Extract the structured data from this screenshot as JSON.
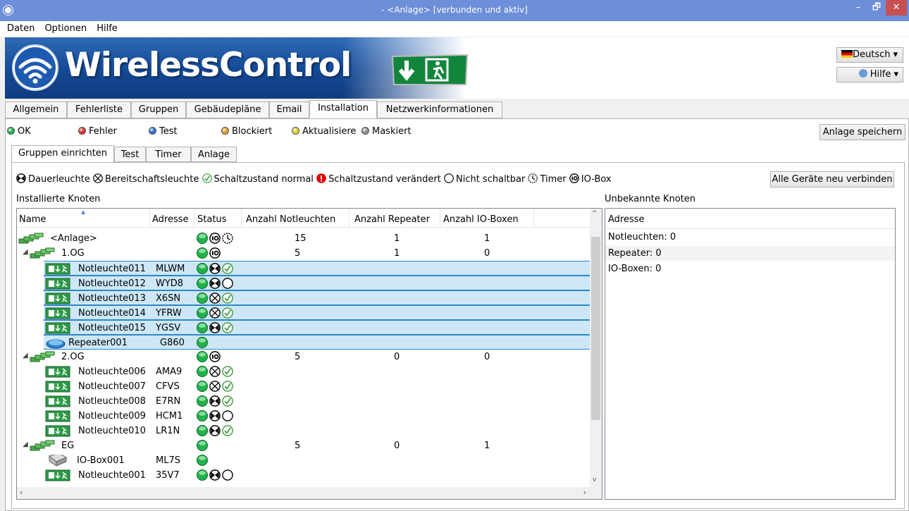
{
  "window": {
    "title": "- <Anlage> [verbunden und aktiv]",
    "minimize": "–",
    "maximize": "🗗",
    "close": "✕"
  },
  "menu": [
    "Daten",
    "Optionen",
    "Hilfe"
  ],
  "banner": {
    "brand": "WirelessControl"
  },
  "lang_button": "Deutsch",
  "help_button": "Hilfe",
  "main_tabs": [
    "Allgemein",
    "Fehlerliste",
    "Gruppen",
    "Gebäudepläne",
    "Email",
    "Installation",
    "Netzwerkinformationen"
  ],
  "active_main_tab": "Installation",
  "status_legend": [
    {
      "label": "OK",
      "color": "#22b14c"
    },
    {
      "label": "Fehler",
      "color": "#e03030"
    },
    {
      "label": "Test",
      "color": "#2f6fd0"
    },
    {
      "label": "Blockiert",
      "color": "#e69a28"
    },
    {
      "label": "Aktualisiere",
      "color": "#e6d028"
    },
    {
      "label": "Maskiert",
      "color": "#909090"
    }
  ],
  "save_button": "Anlage speichern",
  "sub_tabs": [
    "Gruppen einrichten",
    "Test",
    "Timer",
    "Anlage"
  ],
  "active_sub_tab": "Gruppen einrichten",
  "icon_legend": [
    {
      "icon": "maintained-light-icon",
      "label": "Dauerleuchte"
    },
    {
      "icon": "standby-light-icon",
      "label": "Bereitschaftsleuchte"
    },
    {
      "icon": "switch-normal-icon",
      "label": "Schaltzustand normal"
    },
    {
      "icon": "switch-changed-icon",
      "label": "Schaltzustand verändert"
    },
    {
      "icon": "not-switchable-icon",
      "label": "Nicht schaltbar"
    },
    {
      "icon": "timer-icon",
      "label": "Timer"
    },
    {
      "icon": "io-box-icon",
      "label": "IO-Box"
    }
  ],
  "reconnect_button": "Alle Geräte neu verbinden",
  "installed_label": "Installierte Knoten",
  "unknown_label": "Unbekannte Knoten",
  "columns": [
    "Name",
    "Adresse",
    "Status",
    "Anzahl Notleuchten",
    "Anzahl Repeater",
    "Anzahl IO-Boxen"
  ],
  "rows": [
    {
      "name": "<Anlage>",
      "addr": "",
      "level": 0,
      "type": "group",
      "expander": "",
      "status": [
        "ok",
        "io",
        "timer"
      ],
      "n": "15",
      "r": "1",
      "io": "1",
      "sel": false
    },
    {
      "name": "1.OG",
      "addr": "",
      "level": 1,
      "type": "group",
      "expander": "◢",
      "status": [
        "ok",
        "io"
      ],
      "n": "5",
      "r": "1",
      "io": "0",
      "sel": false
    },
    {
      "name": "Notleuchte011",
      "addr": "MLWM",
      "level": 2,
      "type": "light",
      "expander": "",
      "status": [
        "ok",
        "dauer",
        "check"
      ],
      "n": "",
      "r": "",
      "io": "",
      "sel": true
    },
    {
      "name": "Notleuchte012",
      "addr": "WYD8",
      "level": 2,
      "type": "light",
      "expander": "",
      "status": [
        "ok",
        "dauer",
        "circle"
      ],
      "n": "",
      "r": "",
      "io": "",
      "sel": true
    },
    {
      "name": "Notleuchte013",
      "addr": "X6SN",
      "level": 2,
      "type": "light",
      "expander": "",
      "status": [
        "ok",
        "bereit",
        "check"
      ],
      "n": "",
      "r": "",
      "io": "",
      "sel": true
    },
    {
      "name": "Notleuchte014",
      "addr": "YFRW",
      "level": 2,
      "type": "light",
      "expander": "",
      "status": [
        "ok",
        "bereit",
        "check"
      ],
      "n": "",
      "r": "",
      "io": "",
      "sel": true
    },
    {
      "name": "Notleuchte015",
      "addr": "YGSV",
      "level": 2,
      "type": "light",
      "expander": "",
      "status": [
        "ok",
        "dauer",
        "check"
      ],
      "n": "",
      "r": "",
      "io": "",
      "sel": true
    },
    {
      "name": "Repeater001",
      "addr": "G860",
      "level": 2,
      "type": "repeater",
      "expander": "",
      "status": [
        "ok"
      ],
      "n": "",
      "r": "",
      "io": "",
      "sel": true
    },
    {
      "name": "2.OG",
      "addr": "",
      "level": 1,
      "type": "group",
      "expander": "◢",
      "status": [
        "ok",
        "io"
      ],
      "n": "5",
      "r": "0",
      "io": "0",
      "sel": false
    },
    {
      "name": "Notleuchte006",
      "addr": "AMA9",
      "level": 2,
      "type": "light",
      "expander": "",
      "status": [
        "ok",
        "bereit",
        "check"
      ],
      "n": "",
      "r": "",
      "io": "",
      "sel": false
    },
    {
      "name": "Notleuchte007",
      "addr": "CFVS",
      "level": 2,
      "type": "light",
      "expander": "",
      "status": [
        "ok",
        "bereit",
        "check"
      ],
      "n": "",
      "r": "",
      "io": "",
      "sel": false
    },
    {
      "name": "Notleuchte008",
      "addr": "E7RN",
      "level": 2,
      "type": "light",
      "expander": "",
      "status": [
        "ok",
        "dauer",
        "check"
      ],
      "n": "",
      "r": "",
      "io": "",
      "sel": false
    },
    {
      "name": "Notleuchte009",
      "addr": "HCM1",
      "level": 2,
      "type": "light",
      "expander": "",
      "status": [
        "ok",
        "dauer",
        "circle"
      ],
      "n": "",
      "r": "",
      "io": "",
      "sel": false
    },
    {
      "name": "Notleuchte010",
      "addr": "LR1N",
      "level": 2,
      "type": "light",
      "expander": "",
      "status": [
        "ok",
        "dauer",
        "check"
      ],
      "n": "",
      "r": "",
      "io": "",
      "sel": false
    },
    {
      "name": "EG",
      "addr": "",
      "level": 1,
      "type": "group",
      "expander": "◢",
      "status": [
        "ok"
      ],
      "n": "5",
      "r": "0",
      "io": "1",
      "sel": false
    },
    {
      "name": "IO-Box001",
      "addr": "ML7S",
      "level": 2,
      "type": "iobox",
      "expander": "",
      "status": [
        "ok"
      ],
      "n": "",
      "r": "",
      "io": "",
      "sel": false
    },
    {
      "name": "Notleuchte001",
      "addr": "35V7",
      "level": 2,
      "type": "light",
      "expander": "",
      "status": [
        "ok",
        "dauer",
        "circle"
      ],
      "n": "",
      "r": "",
      "io": "",
      "sel": false
    }
  ],
  "unknown": {
    "header": "Adresse",
    "items": [
      "Notleuchten: 0",
      "Repeater: 0",
      "IO-Boxen: 0"
    ]
  },
  "colors": {
    "selection": "#cde7f7",
    "selection_border": "#2c88c7",
    "titlebar": "#6d8ed9",
    "ok_green": "#22b14c"
  }
}
